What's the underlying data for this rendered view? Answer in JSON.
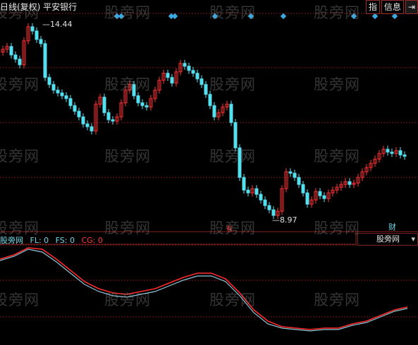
{
  "header": {
    "title": "日线(复权)  平安银行",
    "buttons": [
      "指",
      "信息",
      "⇥"
    ]
  },
  "price_panel": {
    "high_label": "14.44",
    "low_label": "8.97",
    "fin_label": "财",
    "mark_label": "有",
    "colors": {
      "up": "#ff3333",
      "down": "#55e0f0",
      "grid": "#7a1a1a",
      "diamond": "#3aa8e0"
    }
  },
  "indicator": {
    "name": "股旁网",
    "fl": "FL: 0",
    "fs": "FS: 0",
    "cg": "CG: 0",
    "select_value": "股旁网"
  },
  "watermark": "股旁网"
}
